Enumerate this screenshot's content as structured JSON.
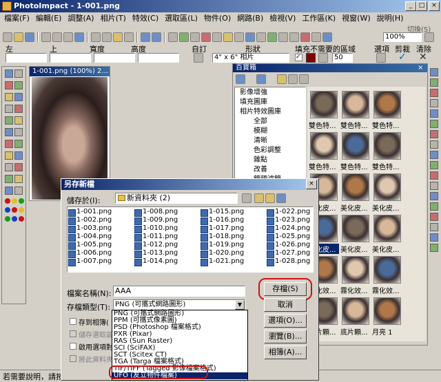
{
  "app": {
    "title": "PhotoImpact - 1-001.png",
    "switch_label": "切換(S)"
  },
  "menu": [
    "檔案(F)",
    "編輯(E)",
    "調整(A)",
    "相片(T)",
    "特效(C)",
    "選取區(L)",
    "物件(O)",
    "網路(B)",
    "檢視(V)",
    "工作區(K)",
    "視窗(W)",
    "說明(H)"
  ],
  "toolbar": {
    "zoom": "100%"
  },
  "attrbar": {
    "left": "左",
    "top": "上",
    "width": "寬度",
    "height": "高度",
    "custom": "自訂",
    "shape": "形狀",
    "fill": "填充不需要的區域",
    "options": "選項",
    "crop": "剪裁",
    "clear": "清除",
    "size_value": "4\" x 6\" 相片",
    "fill_value": "50"
  },
  "doc": {
    "title": "1-001.png (100%) 2..."
  },
  "panel": {
    "title": "百寶箱",
    "tree": [
      "影像增強",
      "填充圖庫",
      "相片特效圖庫",
      "全部",
      "模糊",
      "清晰",
      "色彩調整",
      "雜點",
      "改善",
      "鏡頭濾鏡"
    ],
    "thumbs": [
      "雙色特...",
      "雙色特...",
      "雙色特...",
      "雙色特...",
      "雙色特...",
      "雙色特...",
      "美化皮...",
      "美化皮...",
      "美化皮...",
      "美化皮...",
      "美化皮...",
      "美化皮...",
      "霧化效...",
      "霧化效...",
      "霧化效...",
      "底片顆...",
      "底片顆...",
      "月亮 1"
    ]
  },
  "status": "若需要說明，請按",
  "dialog": {
    "title": "另存新檔",
    "save_in_label": "儲存於(I):",
    "folder": "新資料夾 (2)",
    "files": [
      [
        "1-001.png",
        "1-002.png",
        "1-003.png",
        "1-004.png",
        "1-005.png",
        "1-006.png",
        "1-007.png"
      ],
      [
        "1-008.png",
        "1-009.png",
        "1-010.png",
        "1-011.png",
        "1-012.png",
        "1-013.png",
        "1-014.png"
      ],
      [
        "1-015.png",
        "1-016.png",
        "1-017.png",
        "1-018.png",
        "1-019.png",
        "1-020.png",
        "1-021.png"
      ],
      [
        "1-022.png",
        "1-023.png",
        "1-024.png",
        "1-025.png",
        "1-026.png",
        "1-027.png",
        "1-028.png"
      ]
    ],
    "filename_label": "檔案名稱(N):",
    "filename": "AAA",
    "filetype_label": "存檔類型(T):",
    "filetype": "PNG (可攜式網路圖形)",
    "save": "存檔(S)",
    "cancel": "取消",
    "options": "選項(O)...",
    "browse": "瀏覽(B)...",
    "album": "相簿(A)...",
    "checks": [
      "存到相簿(",
      "儲存選取區",
      "啟用選項對",
      "將此資料夾"
    ],
    "types": [
      "PNG (可攜式網路圖形)",
      "PPM (可攜式像素圖)",
      "PSD (Photoshop 檔案格式)",
      "PXR (Pixar)",
      "RAS (Sun Raster)",
      "SCI (SciFAX)",
      "SCT (Scitex CT)",
      "TGA (Targa 檔案格式)",
      "TIF/TIFF (Tagged 影像檔案格式)",
      "UFO (友立物件檔案)"
    ]
  }
}
